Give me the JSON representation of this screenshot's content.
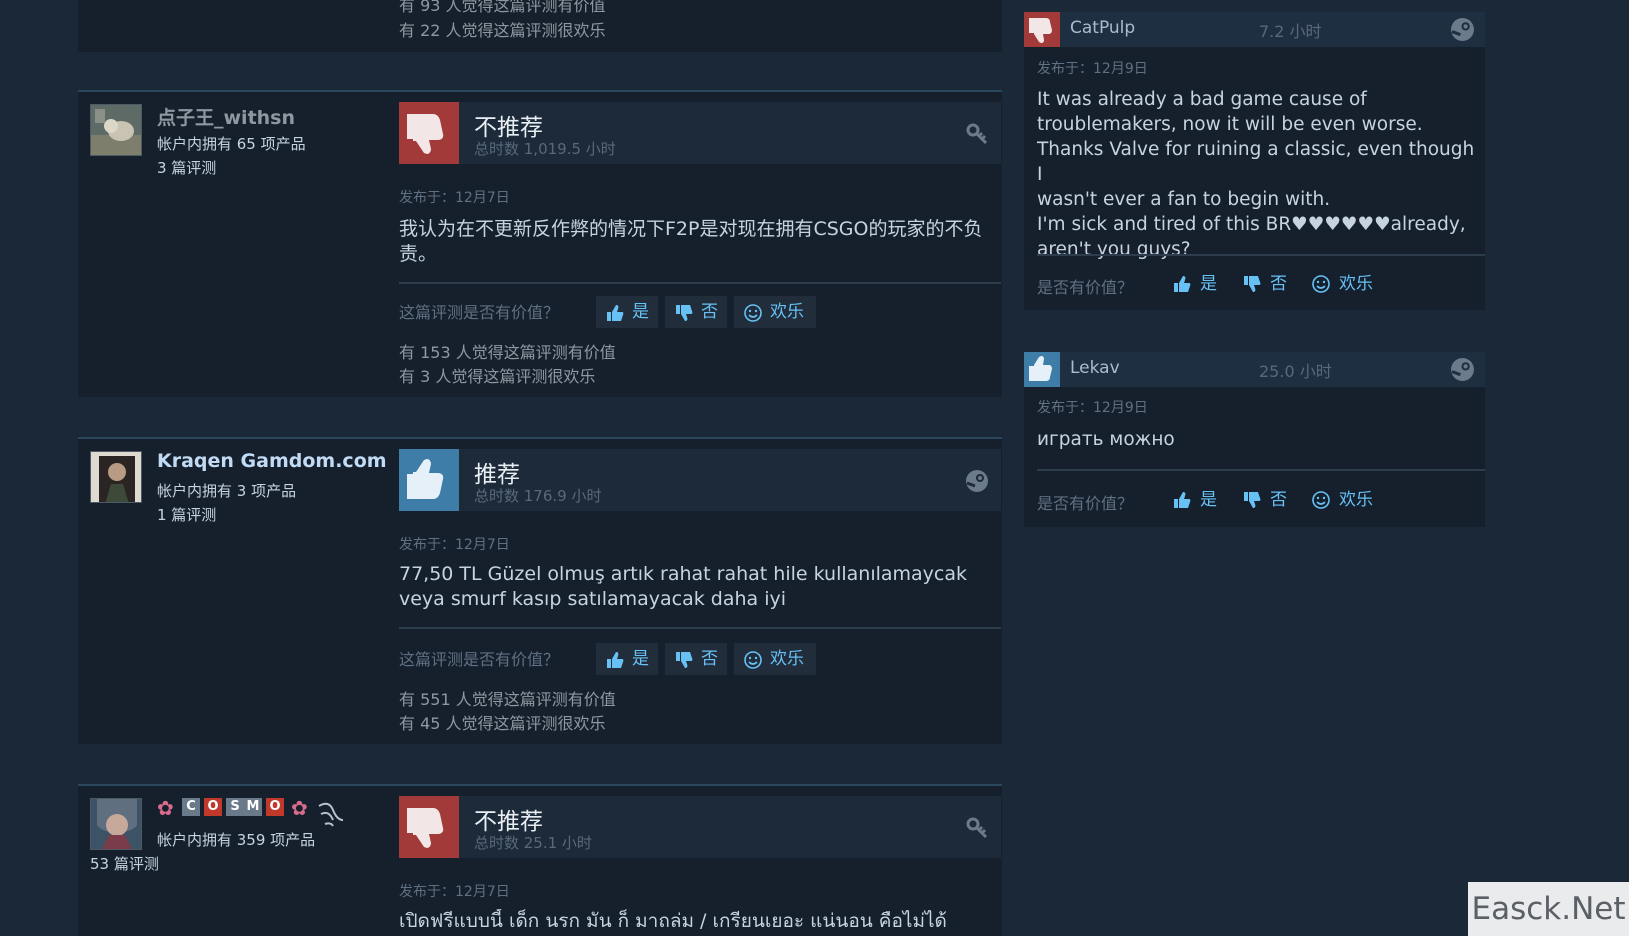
{
  "top_fragment": {
    "helpful": "有 93 人觉得这篇评测有价值",
    "funny": "有 22 人觉得这篇评测很欢乐"
  },
  "reviews": [
    {
      "author": "点子王_withsn",
      "products": "帐户内拥有 65 项产品",
      "review_count": "3 篇评测",
      "verdict": "不推荐",
      "hours": "总时数 1,019.5 小时",
      "posted": "发布于：12月7日",
      "text": "我认为在不更新反作弊的情况下F2P是对现在拥有CSGO的玩家的不负责。",
      "helpful_question": "这篇评测是否有价值？",
      "btn_yes": "是",
      "btn_no": "否",
      "btn_funny": "欢乐",
      "helpful_count": "有 153 人觉得这篇评测有价值",
      "funny_count": "有 3 人觉得这篇评测很欢乐"
    },
    {
      "author": "Kraqen Gamdom.com",
      "products": "帐户内拥有 3 项产品",
      "review_count": "1 篇评测",
      "verdict": "推荐",
      "hours": "总时数 176.9 小时",
      "posted": "发布于：12月7日",
      "text": "77,50 TL Güzel olmuş artık rahat rahat hile kullanılamaycak veya smurf kasıp satılamayacak daha iyi",
      "helpful_question": "这篇评测是否有价值？",
      "btn_yes": "是",
      "btn_no": "否",
      "btn_funny": "欢乐",
      "helpful_count": "有 551 人觉得这篇评测有价值",
      "funny_count": "有 45 人觉得这篇评测很欢乐"
    },
    {
      "author_letters": [
        "C",
        "O",
        "S",
        "M",
        "O"
      ],
      "products": "帐户内拥有 359 项产品",
      "review_count": "53 篇评测",
      "verdict": "不推荐",
      "hours": "总时数 25.1 小时",
      "posted": "发布于：12月7日",
      "text": "เปิดฟรีแบบนี้ เด็ก นรก มัน ก็ มาถล่ม / เกรียนเยอะ แน่นอน คือไม่ได้"
    }
  ],
  "side_reviews": [
    {
      "author": "CatPulp",
      "hours": "7.2 小时",
      "posted": "发布于：12月9日",
      "lines": [
        "It was already a bad game cause of",
        "troublemakers, now it will be even worse.",
        "Thanks Valve for ruining a classic, even though I",
        "wasn't ever a fan to begin with.",
        "I'm sick and tired of this BR♥♥♥♥♥♥already,",
        "aren't you guys?"
      ],
      "question": "是否有价值？",
      "btn_yes": "是",
      "btn_no": "否",
      "btn_funny": "欢乐"
    },
    {
      "author": "Lekav",
      "hours": "25.0 小时",
      "posted": "发布于：12月9日",
      "text": "играть можно",
      "question": "是否有价值？",
      "btn_yes": "是",
      "btn_no": "否",
      "btn_funny": "欢乐"
    }
  ],
  "watermark": "Easck.Net",
  "colors": {
    "page_bg": "#1b2838",
    "card_bg": "#16202d",
    "thumb_down": "#a33a3a",
    "thumb_up": "#3f7da9",
    "link_blue": "#67c1f5"
  }
}
